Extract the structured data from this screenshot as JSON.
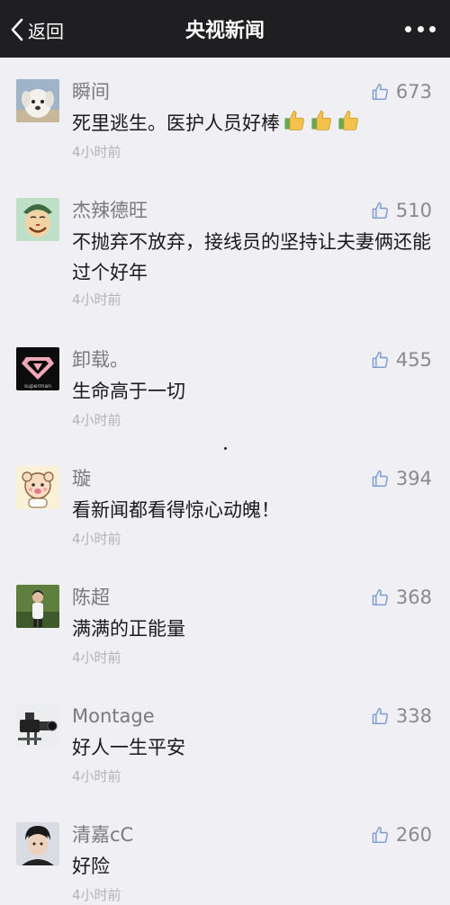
{
  "navbar": {
    "back_label": "返回",
    "title": "央视新闻",
    "more_icon": "more-dots-icon"
  },
  "colors": {
    "navbar_bg": "#1f1f22",
    "page_bg": "#efeff4",
    "name_color": "#7a7a7a",
    "time_color": "#b4b4b4"
  },
  "comments": [
    {
      "name": "瞬间",
      "likes": "673",
      "text": "死里逃生。医护人员好棒",
      "emoji": [
        "thumbs-up-emoji",
        "thumbs-up-emoji",
        "thumbs-up-emoji"
      ],
      "time": "4小时前",
      "avatar": "white-dog-avatar"
    },
    {
      "name": "杰辣德旺",
      "likes": "510",
      "text": "不抛弃不放弃，接线员的坚持让夫妻俩还能过个好年",
      "time": "4小时前",
      "avatar": "cartoon-face-avatar"
    },
    {
      "name": "卸载。",
      "likes": "455",
      "text": "生命高于一切",
      "time": "4小时前",
      "avatar": "superman-logo-avatar",
      "avatar_text": "superman"
    },
    {
      "name": "璇",
      "likes": "394",
      "text": "看新闻都看得惊心动魄！",
      "time": "4小时前",
      "avatar": "cartoon-baby-avatar"
    },
    {
      "name": "陈超",
      "likes": "368",
      "text": "满满的正能量",
      "time": "4小时前",
      "avatar": "person-outdoor-avatar"
    },
    {
      "name": "Montage",
      "likes": "338",
      "text": "好人一生平安",
      "time": "4小时前",
      "avatar": "camera-rig-avatar"
    },
    {
      "name": "清嘉cC",
      "likes": "260",
      "text": "好险",
      "time": "4小时前",
      "avatar": "young-man-portrait-avatar"
    }
  ]
}
